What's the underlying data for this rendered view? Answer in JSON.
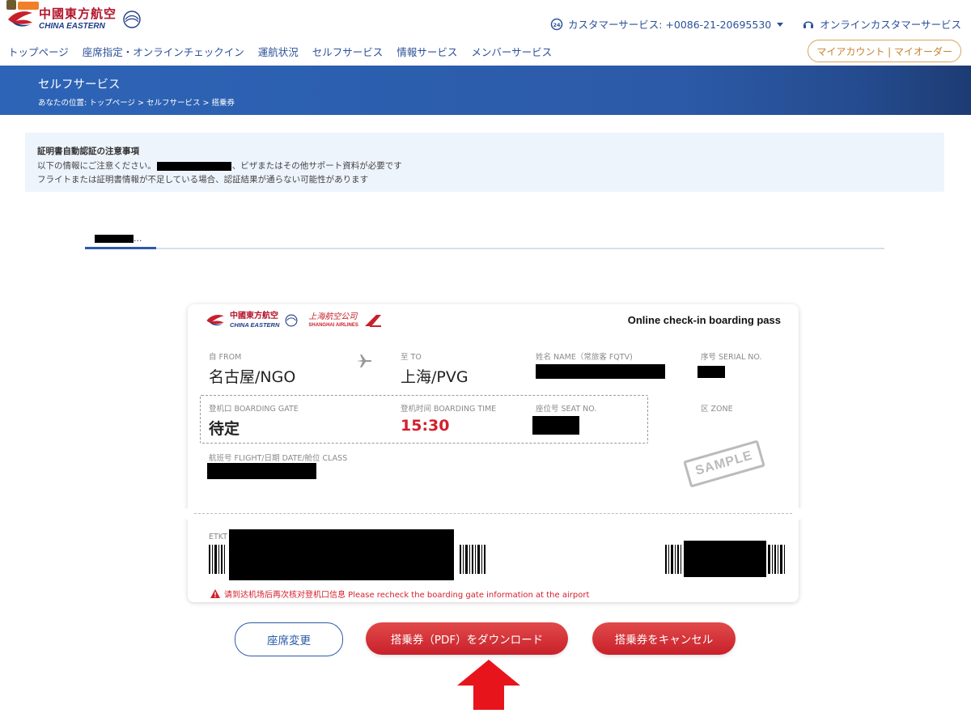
{
  "header": {
    "logo_cn": "中國東方航空",
    "logo_en": "CHINA EASTERN",
    "customer_service": "カスタマーサービス: +0086-21-20695530",
    "online_service": "オンラインカスタマーサービス",
    "nav": [
      "トップページ",
      "座席指定・オンラインチェックイン",
      "運航状況",
      "セルフサービス",
      "情報サービス",
      "メンバーサービス"
    ],
    "account": "マイアカウント | マイオーダー"
  },
  "banner": {
    "title": "セルフサービス",
    "breadcrumb": "あなたの位置: トップページ > セルフサービス > 搭乗券"
  },
  "notice": {
    "title": "証明書自動認証の注意事項",
    "line1_prefix": "以下の情報にご注意ください。",
    "line1_suffix": "、ビザまたはその他サポート資料が必要です",
    "line2": "フライトまたは証明書情報が不足している場合、認証結果が通らない可能性があります"
  },
  "tab": {
    "label": "..."
  },
  "pass": {
    "logo_cn": "中國東方航空",
    "logo_en": "CHINA EASTERN",
    "sa_cn": "上海航空公司",
    "sa_en": "SHANGHAI AIRLINES",
    "title": "Online check-in boarding pass",
    "from_label": "自 FROM",
    "from_value": "名古屋/NGO",
    "to_label": "至 TO",
    "to_value": "上海/PVG",
    "name_label": "姓名 NAME（常旅客 FQTV)",
    "serial_label": "序号 SERIAL NO.",
    "gate_label": "登机口 BOARDING GATE",
    "gate_value": "待定",
    "time_label": "登机时间 BOARDING TIME",
    "time_value": "15:30",
    "seat_label": "座位号 SEAT NO.",
    "zone_label": "区 ZONE",
    "flight_label": "航班号 FLIGHT/日期 DATE/舱位 CLASS",
    "sample": "SAMPLE",
    "etkt_label": "ETKT",
    "warning": "请到达机场后再次核对登机口信息 Please recheck the boarding gate information at the airport"
  },
  "buttons": {
    "change_seat": "座席変更",
    "download": "搭乗券（PDF）をダウンロード",
    "cancel": "搭乗券をキャンセル"
  },
  "colors": {
    "brand_red": "#c8202a",
    "brand_blue": "#2c5aa8",
    "arrow_red": "#e8141c"
  }
}
